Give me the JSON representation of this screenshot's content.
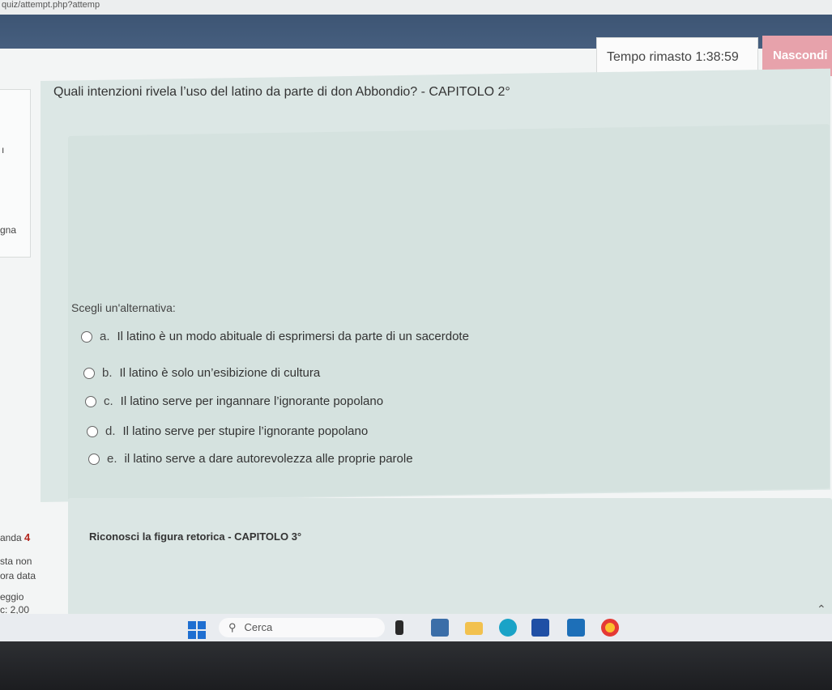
{
  "browser": {
    "url_fragment": "quiz/attempt.php?attemp"
  },
  "timer": {
    "label": "Tempo rimasto",
    "value": "1:38:59"
  },
  "hide_button": {
    "label": "Nascondi"
  },
  "side_panel": {
    "top_fragments": [
      "",
      "ı",
      "gna"
    ],
    "next_question_label": "anda",
    "next_question_number": "4",
    "status_line1": "sta non",
    "status_line2": "ora data",
    "score_label": "eggio",
    "score_value": "c: 2,00"
  },
  "question": {
    "text": "Quali intenzioni rivela l’uso del latino da parte di don Abbondio? - CAPITOLO 2°",
    "prompt": "Scegli un'alternativa:",
    "options": [
      {
        "letter": "a.",
        "text": "Il latino è un modo abituale di esprimersi da parte di un sacerdote"
      },
      {
        "letter": "b.",
        "text": "Il latino è solo un’esibizione di cultura"
      },
      {
        "letter": "c.",
        "text": "Il latino serve per ingannare l’ignorante popolano"
      },
      {
        "letter": "d.",
        "text": "Il latino serve per stupire l’ignorante popolano"
      },
      {
        "letter": "e.",
        "text": "il latino serve a dare autorevolezza alle proprie parole"
      }
    ]
  },
  "next_question": {
    "text": "Riconosci la figura retorica - CAPITOLO 3°"
  },
  "taskbar": {
    "search_placeholder": "Cerca",
    "icons": [
      "windows-start-icon",
      "search-icon",
      "task-view-icon",
      "widgets-icon",
      "file-explorer-icon",
      "edge-icon",
      "store-icon",
      "mail-icon",
      "chrome-icon",
      "chevron-up-icon"
    ],
    "colors": {
      "accent_blue": "#1f6fd1",
      "folder_yellow": "#f2c14e",
      "chrome_yellow": "#fbc02d"
    }
  }
}
